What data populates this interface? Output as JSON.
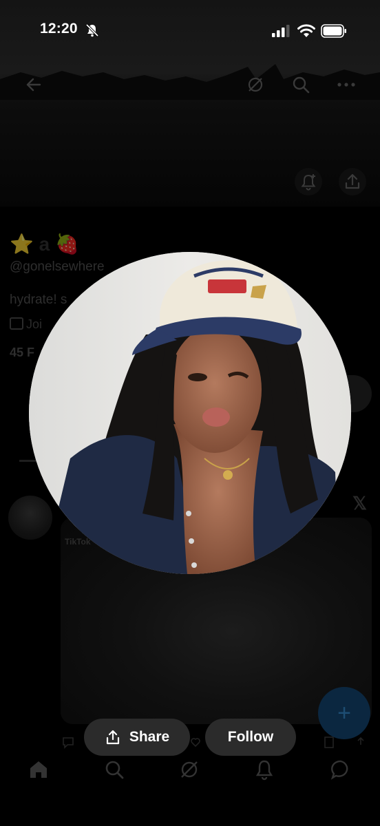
{
  "status_bar": {
    "time": "12:20"
  },
  "profile_bg": {
    "name": "⭐ a 🍓",
    "handle": "@gonelsewhere",
    "bio": "hydrate! s",
    "joined": "Joi",
    "followers": "45 F"
  },
  "card": {
    "source_tag": "TikTok"
  },
  "actions": {
    "share_label": "Share",
    "follow_label": "Follow"
  },
  "fab": {
    "symbol": "+"
  },
  "colors": {
    "background": "#000000",
    "button": "#2b2b2b",
    "fab": "#0b2740"
  }
}
